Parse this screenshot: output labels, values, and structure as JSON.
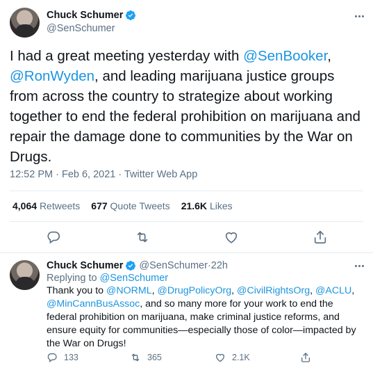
{
  "tweet": {
    "author_name": "Chuck Schumer",
    "author_handle": "@SenSchumer",
    "text_parts": [
      "I had a great meeting yesterday with ",
      "@SenBooker",
      ", ",
      "@RonWyden",
      ", and leading marijuana justice groups from across the country to strategize about working together to end the federal prohibition on marijuana and repair the damage done to communities by the War on Drugs."
    ],
    "time": "12:52 PM",
    "date": "Feb 6, 2021",
    "source": "Twitter Web App",
    "separator": " · ",
    "stats": {
      "retweets_count": "4,064",
      "retweets_label": "Retweets",
      "quotes_count": "677",
      "quotes_label": "Quote Tweets",
      "likes_count": "21.6K",
      "likes_label": "Likes"
    }
  },
  "reply": {
    "author_name": "Chuck Schumer",
    "author_handle": "@SenSchumer",
    "time_ago": "22h",
    "replying_to_label": "Replying to ",
    "replying_to_handle": "@SenSchumer",
    "text_parts": [
      "Thank you to ",
      "@NORML",
      ", ",
      "@DrugPolicyOrg",
      ", ",
      "@CivilRightsOrg",
      ", ",
      "@ACLU",
      ", ",
      "@MinCannBusAssoc",
      ", and so many more for your work to end the federal prohibition on marijuana, make criminal justice reforms, and ensure equity for communities—especially those of color—impacted by the War on Drugs!"
    ],
    "reply_count": "133",
    "retweet_count": "365",
    "like_count": "2.1K"
  },
  "colors": {
    "link": "#1b95e0",
    "secondary_text": "#5b7083",
    "divider": "#e6ecf0",
    "verified": "#1da1f2"
  },
  "icons": [
    "verified-badge-icon",
    "more-options-icon",
    "reply-icon",
    "retweet-icon",
    "like-icon",
    "share-icon"
  ]
}
